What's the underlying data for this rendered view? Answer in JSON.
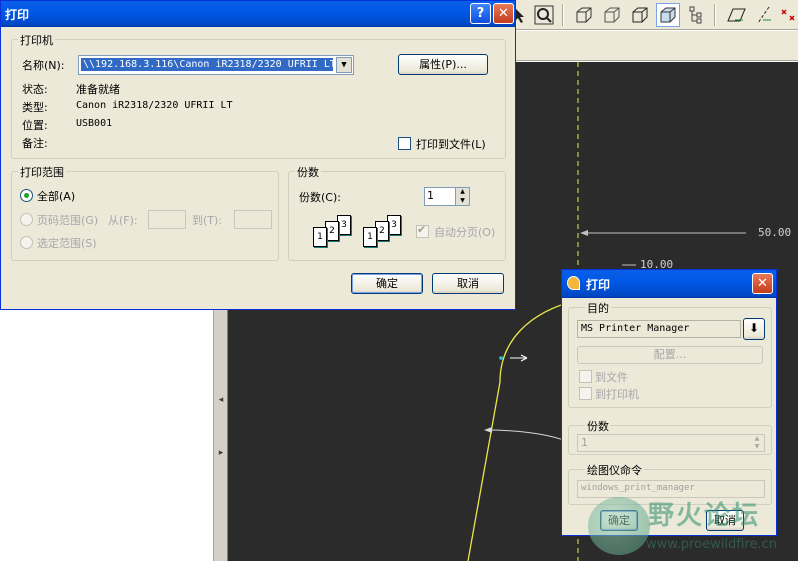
{
  "print_dialog": {
    "title": "打印",
    "help_button": "?",
    "close_button": "✕",
    "printer_group": {
      "label": "打印机",
      "name_label": "名称(N):",
      "name_value": "\\\\192.168.3.116\\Canon iR2318/2320 UFRII LT",
      "properties_button": "属性(P)...",
      "status_label": "状态:",
      "status_value": "准备就绪",
      "type_label": "类型:",
      "type_value": "Canon iR2318/2320 UFRII LT",
      "where_label": "位置:",
      "where_value": "USB001",
      "comment_label": "备注:",
      "print_to_file_label": "打印到文件(L)"
    },
    "range_group": {
      "label": "打印范围",
      "all_label": "全部(A)",
      "pages_label": "页码范围(G)",
      "from_label": "从(F):",
      "to_label": "到(T):",
      "selection_label": "选定范围(S)"
    },
    "copies_group": {
      "label": "份数",
      "copies_label": "份数(C):",
      "copies_value": "1",
      "collate_label": "自动分页(O)",
      "sheet_numbers": [
        "1",
        "2",
        "3"
      ]
    },
    "ok_button": "确定",
    "cancel_button": "取消"
  },
  "plot_dialog": {
    "title": "打印",
    "close_button": "✕",
    "destination_group": {
      "label": "目的",
      "printer_value": "MS Printer Manager",
      "configure_button": "配置...",
      "to_file_label": "到文件",
      "to_printer_label": "到打印机"
    },
    "copies_group": {
      "label": "份数",
      "value": "1"
    },
    "plotter_group": {
      "label": "绘图仪命令",
      "value": "windows_print_manager"
    },
    "ok_button": "确定",
    "cancel_button": "取消"
  },
  "cad_canvas": {
    "dimension_1": "50.00",
    "dimension_2": "10.00"
  },
  "watermark": {
    "site_name": "野火论坛",
    "url": "www.proewildfire.cn"
  },
  "colors": {
    "xp_title_blue": "#0058e6",
    "dialog_face": "#ece9d8",
    "canvas_bg": "#2b2b2b",
    "curve_yellow": "#e8e84a"
  }
}
